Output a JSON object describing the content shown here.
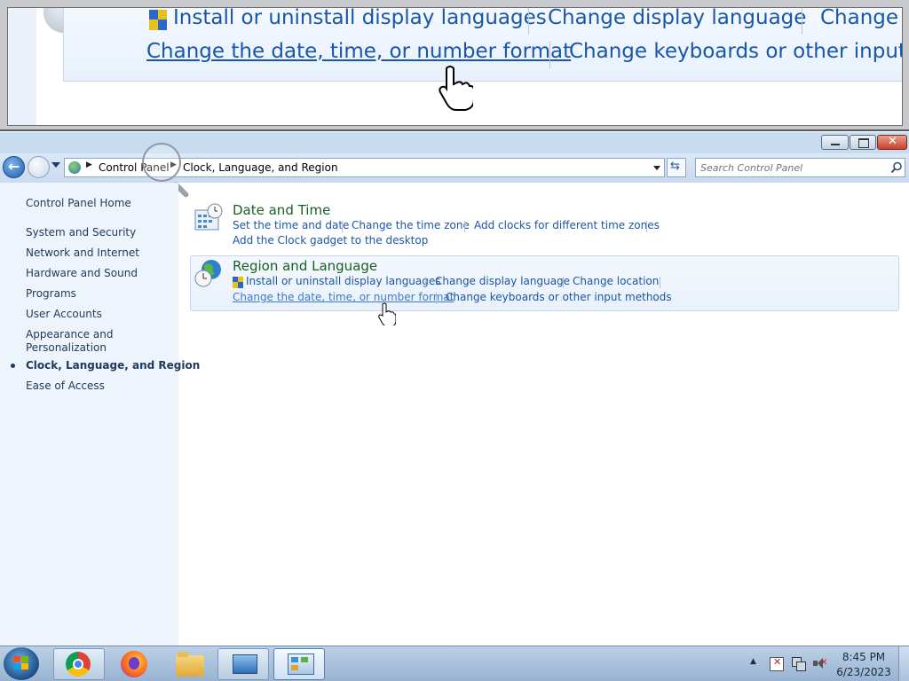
{
  "magnifier": {
    "line1": [
      "Install or uninstall display languages",
      "Change display language",
      "Change l"
    ],
    "line2": [
      "Change the date, time, or number format",
      "Change keyboards or other input m"
    ]
  },
  "window": {
    "controls": {
      "minimize": "minimize-icon",
      "restore": "restore-icon",
      "close": "close-icon"
    }
  },
  "address_bar": {
    "breadcrumbs": [
      "Control Panel",
      "Clock, Language, and Region"
    ],
    "search_placeholder": "Search Control Panel"
  },
  "sidebar": {
    "items": [
      {
        "label": "Control Panel Home",
        "active": false
      },
      {
        "label": "System and Security",
        "active": false
      },
      {
        "label": "Network and Internet",
        "active": false
      },
      {
        "label": "Hardware and Sound",
        "active": false
      },
      {
        "label": "Programs",
        "active": false
      },
      {
        "label": "User Accounts",
        "active": false
      },
      {
        "label": "Appearance and",
        "label2": "Personalization",
        "active": false
      },
      {
        "label": "Clock, Language, and Region",
        "active": true
      },
      {
        "label": "Ease of Access",
        "active": false
      }
    ]
  },
  "main": {
    "categories": [
      {
        "title": "Date and Time",
        "tasks": [
          "Set the time and date",
          "Change the time zone",
          "Add clocks for different time zones",
          "Add the Clock gadget to the desktop"
        ]
      },
      {
        "title": "Region and Language",
        "tasks": [
          "Install or uninstall display languages",
          "Change display language",
          "Change location",
          "Change the date, time, or number format",
          "Change keyboards or other input methods"
        ]
      }
    ]
  },
  "taskbar": {
    "apps": [
      "start-orb",
      "chrome",
      "firefox",
      "file-explorer",
      "control-panel-computer",
      "control-panel-clock-region"
    ],
    "time": "8:45 PM",
    "date": "6/23/2023"
  },
  "colors": {
    "link": "#1a56a8",
    "category_title": "#176125",
    "sidebar_bg": "#eef4fb"
  }
}
